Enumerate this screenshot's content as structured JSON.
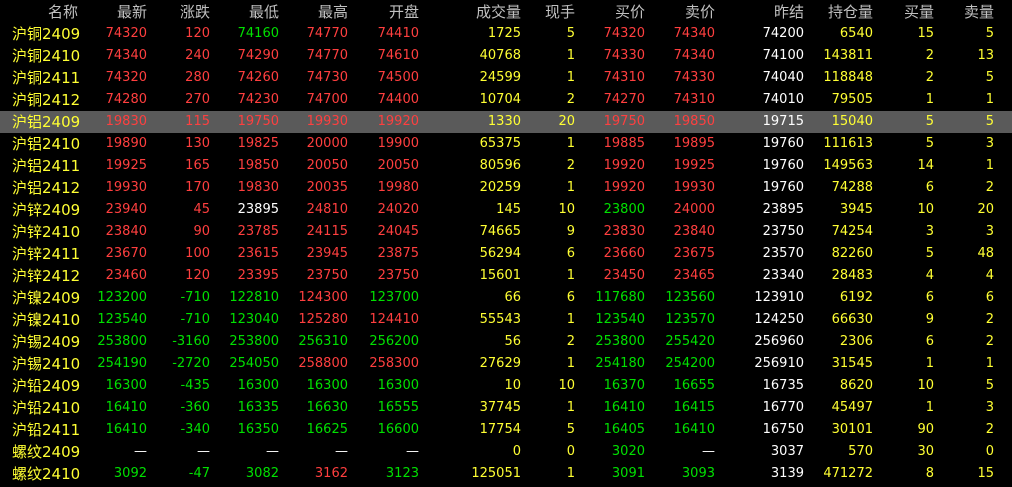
{
  "colors": {
    "up": "#ff3f3f",
    "down": "#00e000",
    "neutral": "#ffffff",
    "yellow": "#ffff33",
    "header": "#c0c0c0",
    "selected_row_bg": "#5a5a5a"
  },
  "headers": [
    "名称",
    "最新",
    "涨跌",
    "最低",
    "最高",
    "开盘",
    "成交量",
    "现手",
    "买价",
    "卖价",
    "昨结",
    "持仓量",
    "买量",
    "卖量"
  ],
  "rows": [
    {
      "name": "沪铜2409",
      "latest": "74320",
      "change": "120",
      "low": "74160",
      "high": "74770",
      "open": "74410",
      "volume": "1725",
      "cur": "5",
      "bid": "74320",
      "ask": "74340",
      "prev_settle": "74200",
      "oi": "6540",
      "bid_vol": "15",
      "ask_vol": "5",
      "c": {
        "latest": "up",
        "change": "up",
        "low": "down",
        "high": "up",
        "open": "up",
        "bid": "up",
        "ask": "up"
      }
    },
    {
      "name": "沪铜2410",
      "latest": "74340",
      "change": "240",
      "low": "74290",
      "high": "74770",
      "open": "74610",
      "volume": "40768",
      "cur": "1",
      "bid": "74330",
      "ask": "74340",
      "prev_settle": "74100",
      "oi": "143811",
      "bid_vol": "2",
      "ask_vol": "13",
      "c": {
        "latest": "up",
        "change": "up",
        "low": "up",
        "high": "up",
        "open": "up",
        "bid": "up",
        "ask": "up"
      }
    },
    {
      "name": "沪铜2411",
      "latest": "74320",
      "change": "280",
      "low": "74260",
      "high": "74730",
      "open": "74500",
      "volume": "24599",
      "cur": "1",
      "bid": "74310",
      "ask": "74330",
      "prev_settle": "74040",
      "oi": "118848",
      "bid_vol": "2",
      "ask_vol": "5",
      "c": {
        "latest": "up",
        "change": "up",
        "low": "up",
        "high": "up",
        "open": "up",
        "bid": "up",
        "ask": "up"
      }
    },
    {
      "name": "沪铜2412",
      "latest": "74280",
      "change": "270",
      "low": "74230",
      "high": "74700",
      "open": "74400",
      "volume": "10704",
      "cur": "2",
      "bid": "74270",
      "ask": "74310",
      "prev_settle": "74010",
      "oi": "79505",
      "bid_vol": "1",
      "ask_vol": "1",
      "c": {
        "latest": "up",
        "change": "up",
        "low": "up",
        "high": "up",
        "open": "up",
        "bid": "up",
        "ask": "up"
      }
    },
    {
      "name": "沪铝2409",
      "latest": "19830",
      "change": "115",
      "low": "19750",
      "high": "19930",
      "open": "19920",
      "volume": "1330",
      "cur": "20",
      "bid": "19750",
      "ask": "19850",
      "prev_settle": "19715",
      "oi": "15040",
      "bid_vol": "5",
      "ask_vol": "5",
      "selected": true,
      "c": {
        "latest": "up",
        "change": "up",
        "low": "up",
        "high": "up",
        "open": "up",
        "bid": "up",
        "ask": "up"
      }
    },
    {
      "name": "沪铝2410",
      "latest": "19890",
      "change": "130",
      "low": "19825",
      "high": "20000",
      "open": "19900",
      "volume": "65375",
      "cur": "1",
      "bid": "19885",
      "ask": "19895",
      "prev_settle": "19760",
      "oi": "111613",
      "bid_vol": "5",
      "ask_vol": "3",
      "c": {
        "latest": "up",
        "change": "up",
        "low": "up",
        "high": "up",
        "open": "up",
        "bid": "up",
        "ask": "up"
      }
    },
    {
      "name": "沪铝2411",
      "latest": "19925",
      "change": "165",
      "low": "19850",
      "high": "20050",
      "open": "20050",
      "volume": "80596",
      "cur": "2",
      "bid": "19920",
      "ask": "19925",
      "prev_settle": "19760",
      "oi": "149563",
      "bid_vol": "14",
      "ask_vol": "1",
      "c": {
        "latest": "up",
        "change": "up",
        "low": "up",
        "high": "up",
        "open": "up",
        "bid": "up",
        "ask": "up"
      }
    },
    {
      "name": "沪铝2412",
      "latest": "19930",
      "change": "170",
      "low": "19830",
      "high": "20035",
      "open": "19980",
      "volume": "20259",
      "cur": "1",
      "bid": "19920",
      "ask": "19930",
      "prev_settle": "19760",
      "oi": "74288",
      "bid_vol": "6",
      "ask_vol": "2",
      "c": {
        "latest": "up",
        "change": "up",
        "low": "up",
        "high": "up",
        "open": "up",
        "bid": "up",
        "ask": "up"
      }
    },
    {
      "name": "沪锌2409",
      "latest": "23940",
      "change": "45",
      "low": "23895",
      "high": "24810",
      "open": "24020",
      "volume": "145",
      "cur": "10",
      "bid": "23800",
      "ask": "24000",
      "prev_settle": "23895",
      "oi": "3945",
      "bid_vol": "10",
      "ask_vol": "20",
      "c": {
        "latest": "up",
        "change": "up",
        "low": "neutral",
        "high": "up",
        "open": "up",
        "bid": "down",
        "ask": "up"
      }
    },
    {
      "name": "沪锌2410",
      "latest": "23840",
      "change": "90",
      "low": "23785",
      "high": "24115",
      "open": "24045",
      "volume": "74665",
      "cur": "9",
      "bid": "23830",
      "ask": "23840",
      "prev_settle": "23750",
      "oi": "74254",
      "bid_vol": "3",
      "ask_vol": "3",
      "c": {
        "latest": "up",
        "change": "up",
        "low": "up",
        "high": "up",
        "open": "up",
        "bid": "up",
        "ask": "up"
      }
    },
    {
      "name": "沪锌2411",
      "latest": "23670",
      "change": "100",
      "low": "23615",
      "high": "23945",
      "open": "23875",
      "volume": "56294",
      "cur": "6",
      "bid": "23660",
      "ask": "23675",
      "prev_settle": "23570",
      "oi": "82260",
      "bid_vol": "5",
      "ask_vol": "48",
      "c": {
        "latest": "up",
        "change": "up",
        "low": "up",
        "high": "up",
        "open": "up",
        "bid": "up",
        "ask": "up"
      }
    },
    {
      "name": "沪锌2412",
      "latest": "23460",
      "change": "120",
      "low": "23395",
      "high": "23750",
      "open": "23750",
      "volume": "15601",
      "cur": "1",
      "bid": "23450",
      "ask": "23465",
      "prev_settle": "23340",
      "oi": "28483",
      "bid_vol": "4",
      "ask_vol": "4",
      "c": {
        "latest": "up",
        "change": "up",
        "low": "up",
        "high": "up",
        "open": "up",
        "bid": "up",
        "ask": "up"
      }
    },
    {
      "name": "沪镍2409",
      "latest": "123200",
      "change": "-710",
      "low": "122810",
      "high": "124300",
      "open": "123700",
      "volume": "66",
      "cur": "6",
      "bid": "117680",
      "ask": "123560",
      "prev_settle": "123910",
      "oi": "6192",
      "bid_vol": "6",
      "ask_vol": "6",
      "c": {
        "latest": "down",
        "change": "down",
        "low": "down",
        "high": "up",
        "open": "down",
        "bid": "down",
        "ask": "down"
      }
    },
    {
      "name": "沪镍2410",
      "latest": "123540",
      "change": "-710",
      "low": "123040",
      "high": "125280",
      "open": "124410",
      "volume": "55543",
      "cur": "1",
      "bid": "123540",
      "ask": "123570",
      "prev_settle": "124250",
      "oi": "66630",
      "bid_vol": "9",
      "ask_vol": "2",
      "c": {
        "latest": "down",
        "change": "down",
        "low": "down",
        "high": "up",
        "open": "up",
        "bid": "down",
        "ask": "down"
      }
    },
    {
      "name": "沪锡2409",
      "latest": "253800",
      "change": "-3160",
      "low": "253800",
      "high": "256310",
      "open": "256200",
      "volume": "56",
      "cur": "2",
      "bid": "253800",
      "ask": "255420",
      "prev_settle": "256960",
      "oi": "2306",
      "bid_vol": "6",
      "ask_vol": "2",
      "c": {
        "latest": "down",
        "change": "down",
        "low": "down",
        "high": "down",
        "open": "down",
        "bid": "down",
        "ask": "down"
      }
    },
    {
      "name": "沪锡2410",
      "latest": "254190",
      "change": "-2720",
      "low": "254050",
      "high": "258800",
      "open": "258300",
      "volume": "27629",
      "cur": "1",
      "bid": "254180",
      "ask": "254200",
      "prev_settle": "256910",
      "oi": "31545",
      "bid_vol": "1",
      "ask_vol": "1",
      "c": {
        "latest": "down",
        "change": "down",
        "low": "down",
        "high": "up",
        "open": "up",
        "bid": "down",
        "ask": "down"
      }
    },
    {
      "name": "沪铅2409",
      "latest": "16300",
      "change": "-435",
      "low": "16300",
      "high": "16300",
      "open": "16300",
      "volume": "10",
      "cur": "10",
      "bid": "16370",
      "ask": "16655",
      "prev_settle": "16735",
      "oi": "8620",
      "bid_vol": "10",
      "ask_vol": "5",
      "c": {
        "latest": "down",
        "change": "down",
        "low": "down",
        "high": "down",
        "open": "down",
        "bid": "down",
        "ask": "down"
      }
    },
    {
      "name": "沪铅2410",
      "latest": "16410",
      "change": "-360",
      "low": "16335",
      "high": "16630",
      "open": "16555",
      "volume": "37745",
      "cur": "1",
      "bid": "16410",
      "ask": "16415",
      "prev_settle": "16770",
      "oi": "45497",
      "bid_vol": "1",
      "ask_vol": "3",
      "c": {
        "latest": "down",
        "change": "down",
        "low": "down",
        "high": "down",
        "open": "down",
        "bid": "down",
        "ask": "down"
      }
    },
    {
      "name": "沪铅2411",
      "latest": "16410",
      "change": "-340",
      "low": "16350",
      "high": "16625",
      "open": "16600",
      "volume": "17754",
      "cur": "5",
      "bid": "16405",
      "ask": "16410",
      "prev_settle": "16750",
      "oi": "30101",
      "bid_vol": "90",
      "ask_vol": "2",
      "c": {
        "latest": "down",
        "change": "down",
        "low": "down",
        "high": "down",
        "open": "down",
        "bid": "down",
        "ask": "down"
      }
    },
    {
      "name": "螺纹2409",
      "latest": "—",
      "change": "—",
      "low": "—",
      "high": "—",
      "open": "—",
      "volume": "0",
      "cur": "0",
      "bid": "3020",
      "ask": "—",
      "prev_settle": "3037",
      "oi": "570",
      "bid_vol": "30",
      "ask_vol": "0",
      "c": {
        "latest": "neutral",
        "change": "neutral",
        "low": "neutral",
        "high": "neutral",
        "open": "neutral",
        "bid": "down",
        "ask": "neutral"
      }
    },
    {
      "name": "螺纹2410",
      "latest": "3092",
      "change": "-47",
      "low": "3082",
      "high": "3162",
      "open": "3123",
      "volume": "125051",
      "cur": "1",
      "bid": "3091",
      "ask": "3093",
      "prev_settle": "3139",
      "oi": "471272",
      "bid_vol": "8",
      "ask_vol": "15",
      "c": {
        "latest": "down",
        "change": "down",
        "low": "down",
        "high": "up",
        "open": "down",
        "bid": "down",
        "ask": "down"
      }
    }
  ]
}
